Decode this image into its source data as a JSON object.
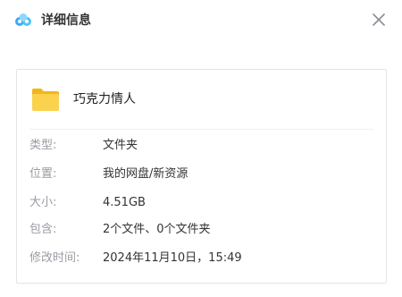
{
  "window": {
    "title": "详细信息",
    "logo_icon": "baidu-netdisk-logo-icon",
    "close_icon": "close-icon"
  },
  "file": {
    "icon": "folder-icon",
    "name": "巧克力情人"
  },
  "details": {
    "type": {
      "label": "类型:",
      "value": "文件夹"
    },
    "location": {
      "label": "位置:",
      "value": "我的网盘/新资源"
    },
    "size": {
      "label": "大小:",
      "value": "4.51GB"
    },
    "contains": {
      "label": "包含:",
      "value": "2个文件、0个文件夹"
    },
    "modified": {
      "label": "修改时间:",
      "value": "2024年11月10日，15:49"
    }
  },
  "colors": {
    "folder": "#f7c531",
    "folder_front": "#fbd24e",
    "label": "#9a9ca3",
    "value": "#333333",
    "border": "#e3e4e8"
  }
}
